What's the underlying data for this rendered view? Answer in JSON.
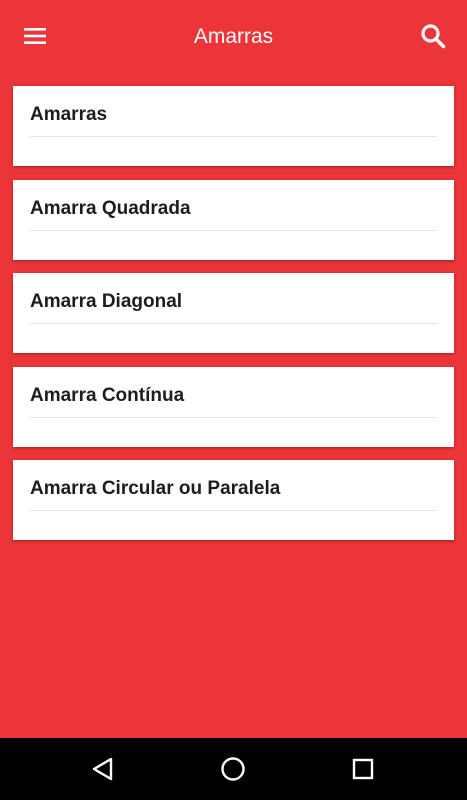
{
  "header": {
    "title": "Amarras",
    "menu_icon": "hamburger-menu-icon",
    "search_icon": "search-icon"
  },
  "list": {
    "items": [
      {
        "label": "Amarras"
      },
      {
        "label": "Amarra Quadrada"
      },
      {
        "label": "Amarra Diagonal"
      },
      {
        "label": "Amarra Contínua"
      },
      {
        "label": "Amarra Circular ou Paralela"
      }
    ]
  },
  "navbar": {
    "back_icon": "back-triangle-icon",
    "home_icon": "home-circle-icon",
    "recents_icon": "recents-square-icon"
  },
  "colors": {
    "primary": "#EC3538",
    "card": "#FFFFFF",
    "navbar": "#000000"
  }
}
